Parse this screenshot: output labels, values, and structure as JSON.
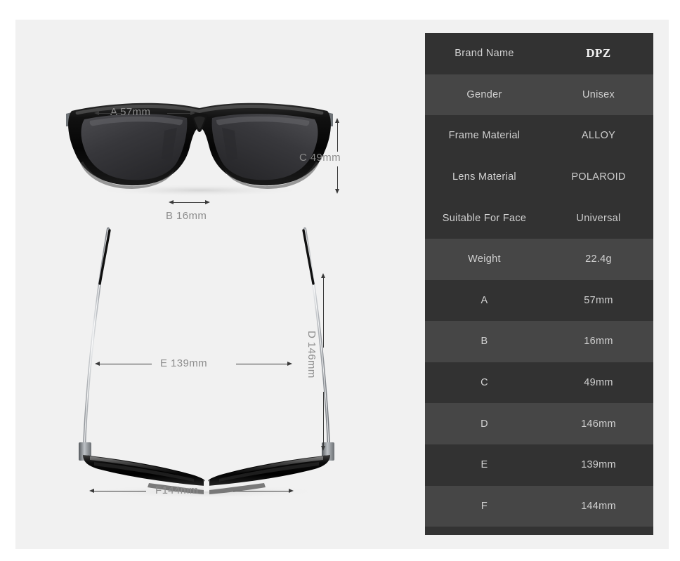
{
  "product": {
    "brand": "DPZ",
    "type": "sunglasses"
  },
  "diagram": {
    "front_view": {
      "name": "sunglasses-front-view",
      "measurements": [
        {
          "key": "A",
          "label": "A 57mm",
          "value": "57mm",
          "orientation": "horizontal",
          "describes": "lens-width"
        },
        {
          "key": "B",
          "label": "B 16mm",
          "value": "16mm",
          "orientation": "horizontal",
          "describes": "bridge-width"
        },
        {
          "key": "C",
          "label": "C 49mm",
          "value": "49mm",
          "orientation": "vertical",
          "describes": "lens-height"
        }
      ]
    },
    "top_view": {
      "name": "sunglasses-top-view",
      "measurements": [
        {
          "key": "D",
          "label": "D 146mm",
          "value": "146mm",
          "orientation": "vertical",
          "describes": "temple-length"
        },
        {
          "key": "E",
          "label": "E 139mm",
          "value": "139mm",
          "orientation": "horizontal",
          "describes": "inner-frame-width"
        },
        {
          "key": "F",
          "label": "F144mm",
          "value": "144mm",
          "orientation": "horizontal",
          "describes": "total-frame-width"
        }
      ]
    }
  },
  "spec_table": {
    "rows": [
      {
        "label": "Brand Name",
        "value": "DPZ",
        "style": "brand"
      },
      {
        "label": "Gender",
        "value": "Unisex",
        "style": "normal"
      },
      {
        "label": "Frame Material",
        "value": "ALLOY",
        "style": "normal"
      },
      {
        "label": "Lens Material",
        "value": "POLAROID",
        "style": "normal"
      },
      {
        "label": "Suitable For Face",
        "value": "Universal",
        "style": "normal"
      },
      {
        "label": "Weight",
        "value": "22.4g",
        "style": "normal"
      },
      {
        "label": "A",
        "value": "57mm",
        "style": "normal"
      },
      {
        "label": "B",
        "value": "16mm",
        "style": "normal"
      },
      {
        "label": "C",
        "value": "49mm",
        "style": "normal"
      },
      {
        "label": "D",
        "value": "146mm",
        "style": "normal"
      },
      {
        "label": "E",
        "value": "139mm",
        "style": "normal"
      },
      {
        "label": "F",
        "value": "144mm",
        "style": "normal"
      }
    ]
  },
  "colors": {
    "page_background": "#ffffff",
    "panel_background": "#f1f1f1",
    "table_row_dark": "#323232",
    "table_row_light": "#464646",
    "label_text": "#d2d2d2",
    "dimension_text": "#8d8d8d",
    "arrow": "#3a3a3a",
    "frame_black": "#0d0d0d",
    "lens_gray": "#3a3a3d",
    "temple_silver": "#b9bcc0"
  }
}
